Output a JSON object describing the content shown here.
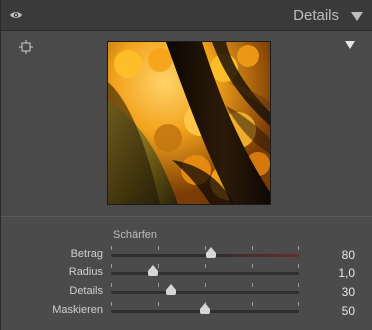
{
  "header": {
    "title": "Details",
    "eye_icon": "eye-icon",
    "collapse_icon": "collapse-triangle-icon"
  },
  "preview": {
    "target_icon": "target-crosshair-icon",
    "menu_icon": "menu-triangle-icon",
    "image": "autumn-leaves-zoom-preview"
  },
  "sharpen": {
    "section_title": "Schärfen",
    "sliders": [
      {
        "label": "Betrag",
        "value": "80",
        "fraction": 0.53
      },
      {
        "label": "Radius",
        "value": "1,0",
        "fraction": 0.22
      },
      {
        "label": "Details",
        "value": "30",
        "fraction": 0.32
      },
      {
        "label": "Maskieren",
        "value": "50",
        "fraction": 0.5
      }
    ]
  },
  "colors": {
    "panel": "#3c3c3c",
    "section": "#4b4b4b",
    "text": "#cfcfcf",
    "slider_red": "#6b2a2a"
  }
}
